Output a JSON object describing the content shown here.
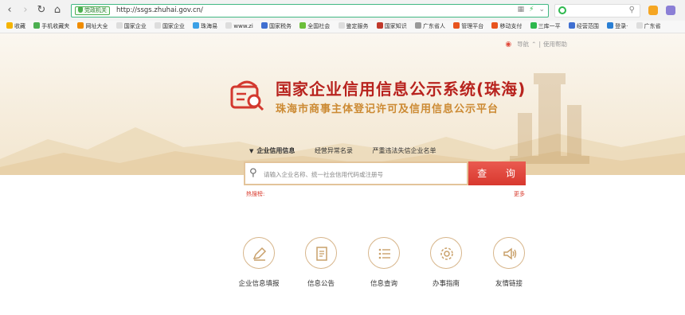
{
  "browser": {
    "gov_badge": "党政机关",
    "url": "http://ssgs.zhuhai.gov.cn/",
    "bookmarks": [
      "收藏",
      "手机收藏夹",
      "网址大全",
      "国家企业",
      "国家企业",
      "珠海易",
      "www.zi",
      "国家税务",
      "全国社会",
      "鉴定服务",
      "国家知识",
      "广东省人",
      "管理平台",
      "移动支付",
      "三库一平",
      "经营范围",
      "登录·",
      "广东省"
    ]
  },
  "page": {
    "top_links": {
      "nav": "导航",
      "sep": "|",
      "help": "使用帮助"
    },
    "title": "国家企业信用信息公示系统(珠海)",
    "subtitle": "珠海市商事主体登记许可及信用信息公示平台",
    "tabs": [
      "企业信用信息",
      "经营异常名录",
      "严重违法失信企业名单"
    ],
    "search": {
      "placeholder": "请输入企业名称、统一社会信用代码或注册号",
      "button": "查 询"
    },
    "hot_label": "热搜榜:",
    "more": "更多",
    "services": [
      "企业信息填报",
      "信息公告",
      "信息查询",
      "办事指南",
      "友情链接"
    ]
  },
  "colors": {
    "brand_red": "#b8231e",
    "brand_gold": "#cc8a33",
    "accent_border": "#d7b58a"
  }
}
